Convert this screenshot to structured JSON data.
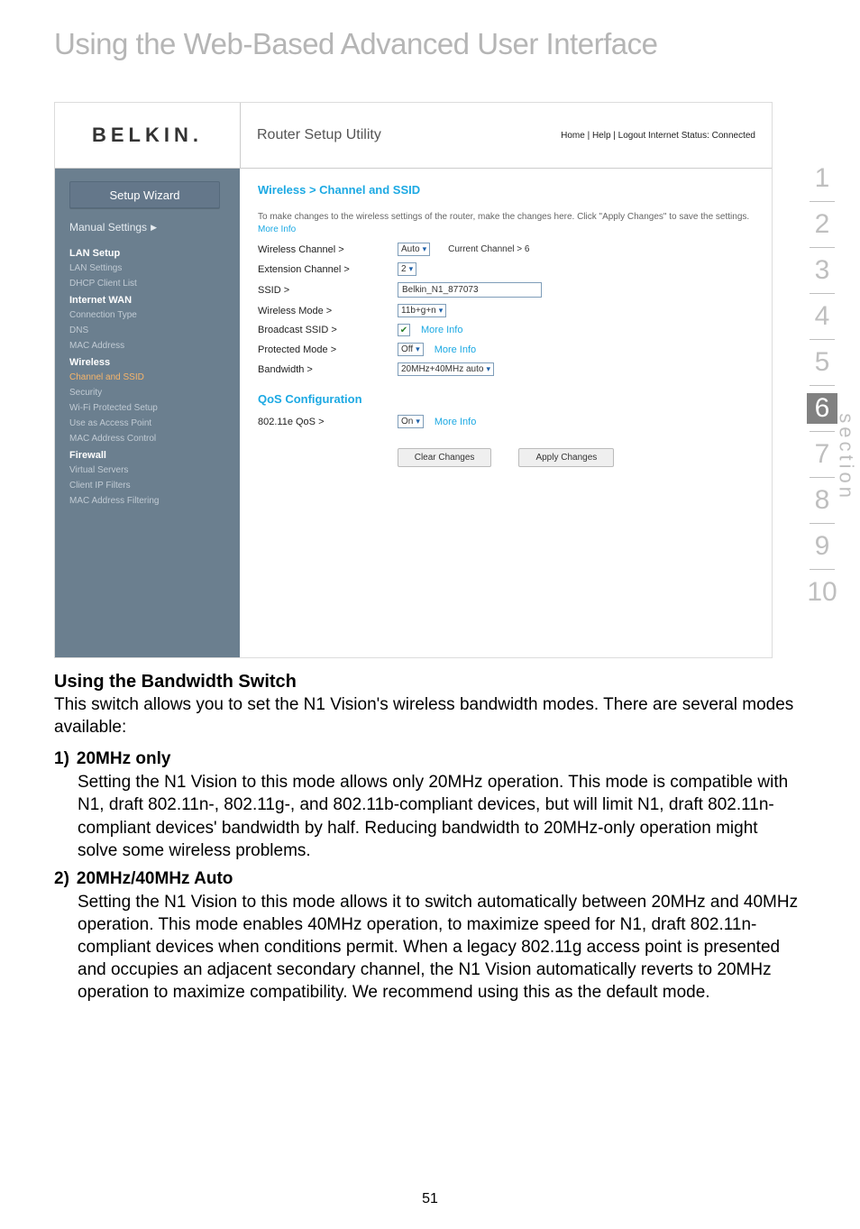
{
  "page_title": "Using the Web-Based Advanced User Interface",
  "page_number": "51",
  "section_label": "section",
  "steps": [
    "1",
    "2",
    "3",
    "4",
    "5",
    "6",
    "7",
    "8",
    "9",
    "10"
  ],
  "current_step": 6,
  "screenshot": {
    "logo": "BELKIN.",
    "utility_title": "Router Setup Utility",
    "top_links": "Home | Help | Logout   Internet Status: Connected",
    "setup_wizard": "Setup Wizard",
    "manual_settings": "Manual Settings",
    "nav": {
      "lan": {
        "head": "LAN Setup",
        "items": [
          "LAN Settings",
          "DHCP Client List"
        ]
      },
      "wan": {
        "head": "Internet WAN",
        "items": [
          "Connection Type",
          "DNS",
          "MAC Address"
        ]
      },
      "wireless": {
        "head": "Wireless",
        "items": [
          "Channel and SSID",
          "Security",
          "Wi-Fi Protected Setup",
          "Use as Access Point",
          "MAC Address Control"
        ]
      },
      "firewall": {
        "head": "Firewall",
        "items": [
          "Virtual Servers",
          "Client IP Filters",
          "MAC Address Filtering"
        ]
      }
    },
    "breadcrumb": "Wireless > Channel and SSID",
    "intro_text": "To make changes to the wireless settings of the router, make the changes here. Click \"Apply Changes\" to save the settings.",
    "more_info": "More Info",
    "rows": {
      "wireless_channel": {
        "label": "Wireless Channel >",
        "value": "Auto",
        "current": "Current Channel > 6"
      },
      "extension_channel": {
        "label": "Extension Channel >",
        "value": "2"
      },
      "ssid": {
        "label": "SSID >",
        "value": "Belkin_N1_877073"
      },
      "wireless_mode": {
        "label": "Wireless Mode >",
        "value": "11b+g+n"
      },
      "broadcast_ssid": {
        "label": "Broadcast SSID >"
      },
      "protected_mode": {
        "label": "Protected Mode >",
        "value": "Off"
      },
      "bandwidth": {
        "label": "Bandwidth >",
        "value": "20MHz+40MHz auto"
      }
    },
    "qos_head": "QoS Configuration",
    "qos_row": {
      "label": "802.11e QoS >",
      "value": "On"
    },
    "clear_changes": "Clear Changes",
    "apply_changes": "Apply Changes"
  },
  "doc": {
    "h2": "Using the Bandwidth Switch",
    "intro": "This switch allows you to set the N1 Vision's wireless bandwidth modes. There are several modes available:",
    "item1_num": "1)",
    "item1_head": "20MHz only",
    "item1_body": "Setting the N1 Vision to this mode allows only 20MHz operation. This mode is compatible with N1, draft 802.11n-, 802.11g-, and 802.11b-compliant devices, but will limit N1, draft 802.11n-compliant devices' bandwidth by half. Reducing bandwidth to 20MHz-only operation might solve some wireless problems.",
    "item2_num": "2)",
    "item2_head": "20MHz/40MHz Auto",
    "item2_body": "Setting the N1 Vision to this mode allows it to switch automatically between 20MHz and 40MHz operation. This mode enables 40MHz operation, to maximize speed for N1, draft 802.11n-compliant devices when conditions permit. When a legacy 802.11g access point is presented and occupies an adjacent secondary channel, the N1 Vision automatically reverts to 20MHz operation to maximize compatibility. We recommend using this as the default mode."
  }
}
